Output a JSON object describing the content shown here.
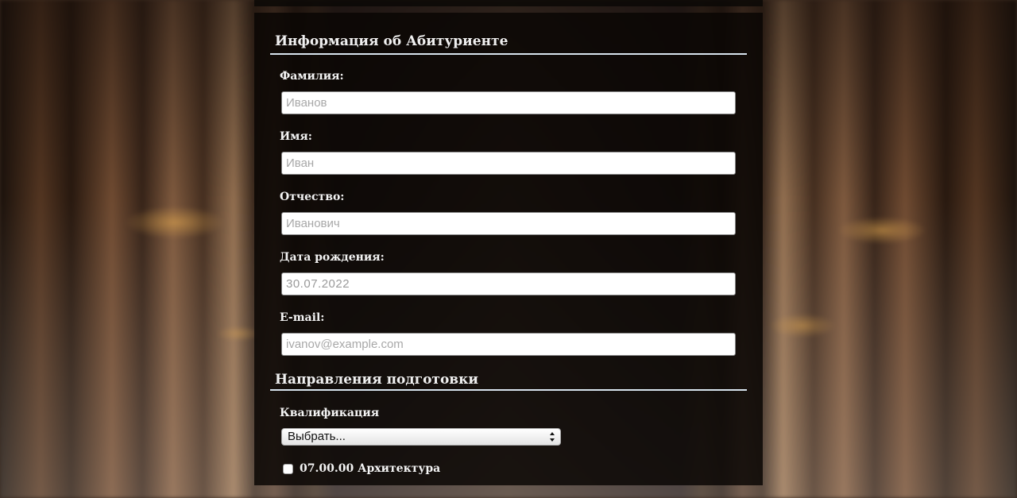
{
  "applicant_section": {
    "title": "Информация об Абитуриенте",
    "surname": {
      "label": "Фамилия:",
      "placeholder": "Иванов"
    },
    "name": {
      "label": "Имя:",
      "placeholder": "Иван"
    },
    "patronymic": {
      "label": "Отчество:",
      "placeholder": "Иванович"
    },
    "birth_date": {
      "label": "Дата рождения:",
      "value": "30.07.2022"
    },
    "email": {
      "label": "E-mail:",
      "placeholder": "ivanov@example.com"
    }
  },
  "directions_section": {
    "title": "Направления подготовки",
    "qualification": {
      "label": "Квалификация",
      "selected": "Выбрать..."
    },
    "checkboxes": [
      {
        "label": "07.00.00 Архитектура",
        "checked": false
      }
    ]
  }
}
